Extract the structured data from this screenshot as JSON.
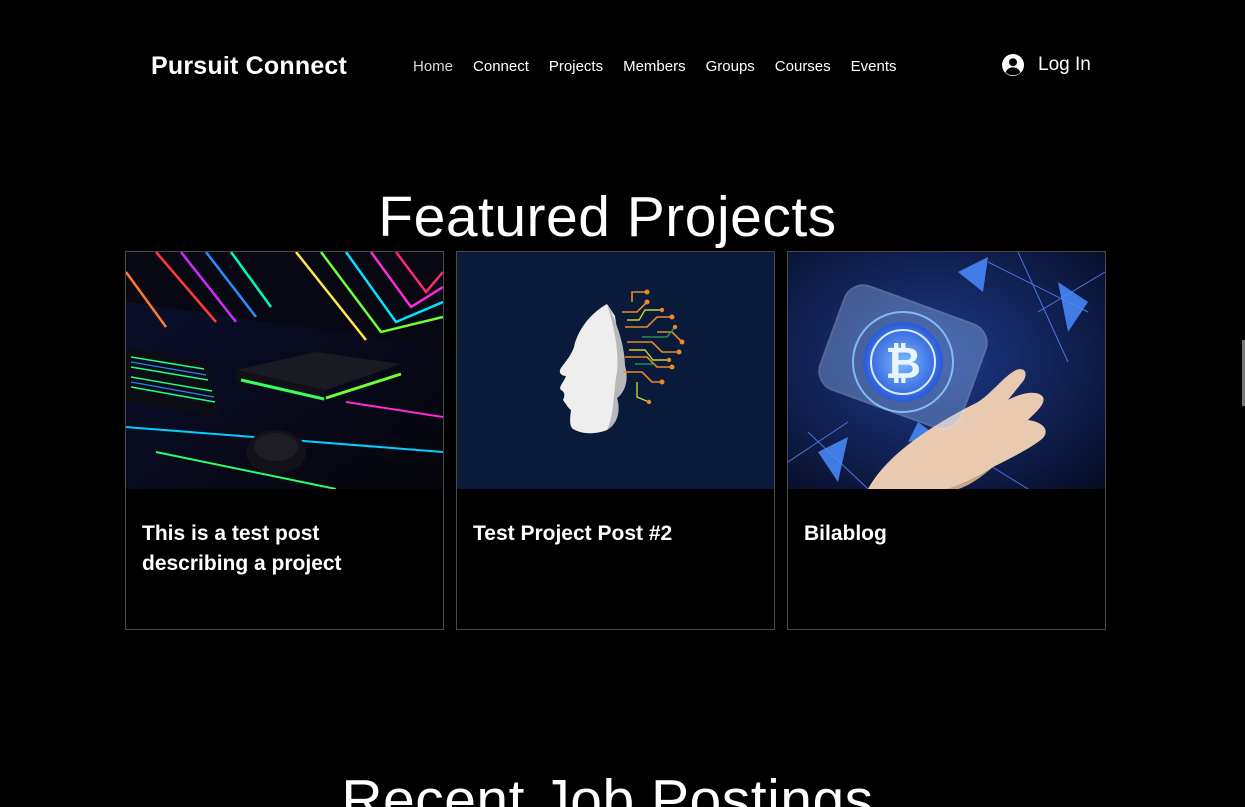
{
  "header": {
    "brand": "Pursuit Connect",
    "nav": [
      {
        "label": "Home",
        "active": true
      },
      {
        "label": "Connect"
      },
      {
        "label": "Projects"
      },
      {
        "label": "Members"
      },
      {
        "label": "Groups"
      },
      {
        "label": "Courses"
      },
      {
        "label": "Events"
      }
    ],
    "login_label": "Log In",
    "login_icon": "user-avatar-icon"
  },
  "featured": {
    "title": "Featured Projects",
    "cards": [
      {
        "title": "This is a test post describing a project",
        "image": "gaming-setup-neon-image"
      },
      {
        "title": "Test Project Post #2",
        "image": "ai-head-circuit-image"
      },
      {
        "title": "Bilablog",
        "image": "bitcoin-phone-hand-image"
      }
    ]
  },
  "jobs": {
    "title": "Recent Job Postings"
  },
  "colors": {
    "background": "#000000",
    "text": "#ffffff",
    "card_border": "#4a4a4a",
    "ai_card_bg": "#0a1a3a"
  }
}
